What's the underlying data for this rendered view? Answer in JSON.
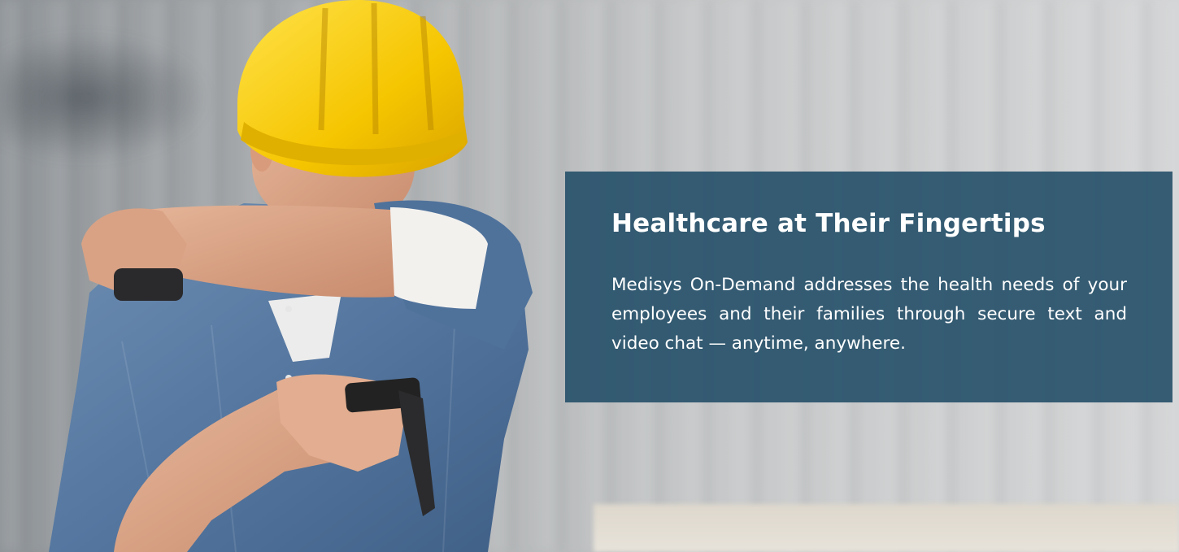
{
  "hero": {
    "image_alt": "Construction worker in yellow hard hat sneezing into elbow while holding a phone",
    "overlay_color": "#244f68",
    "heading": "Healthcare at Their Fingertips",
    "body": "Medisys On-Demand addresses the health needs of your employees and their families through secure text and video chat — anytime, anywhere."
  }
}
